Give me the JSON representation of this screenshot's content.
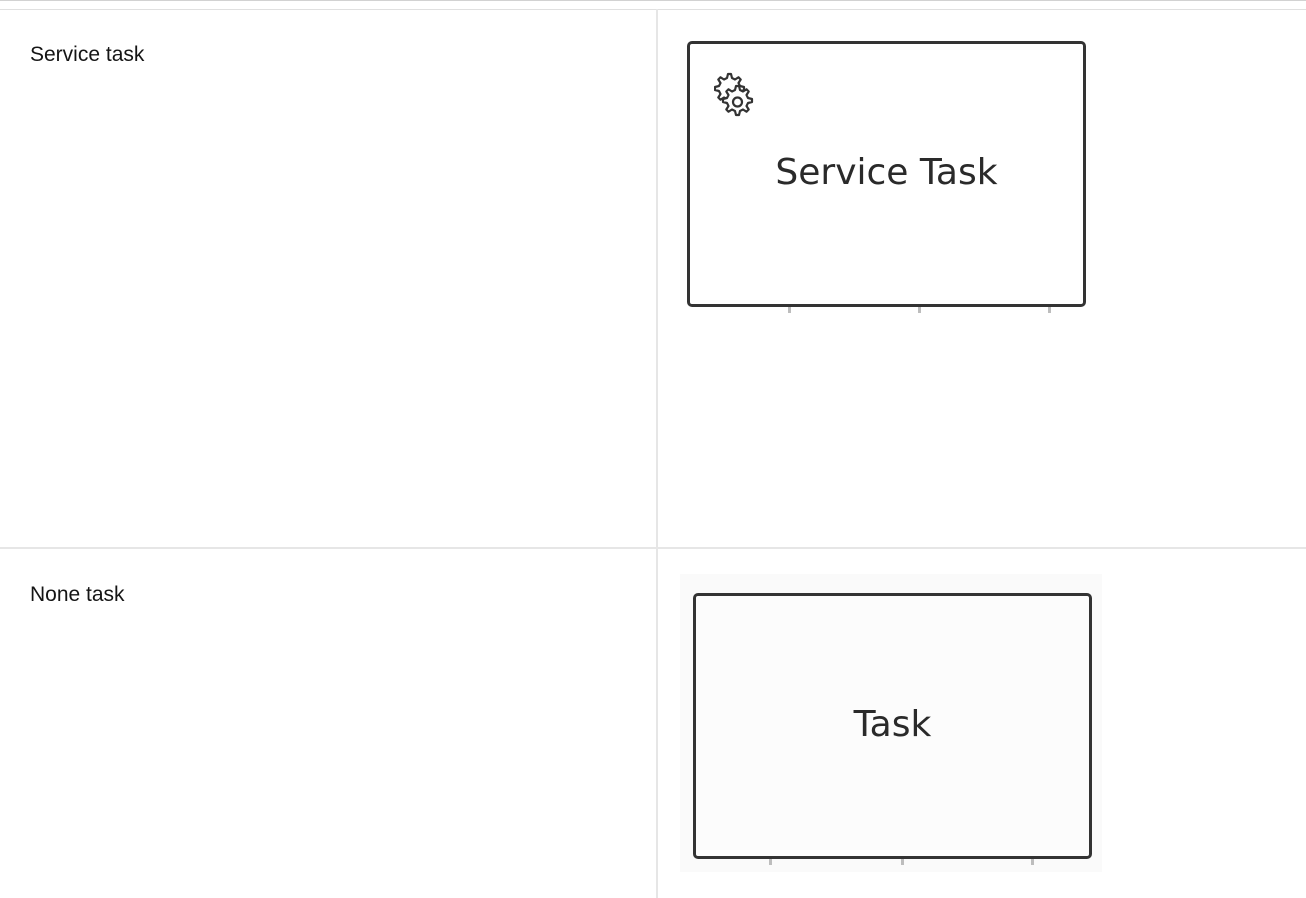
{
  "rows": [
    {
      "label": "Service task",
      "shape_label": "Service Task",
      "icon": "gear-icon"
    },
    {
      "label": "None task",
      "shape_label": "Task"
    }
  ]
}
